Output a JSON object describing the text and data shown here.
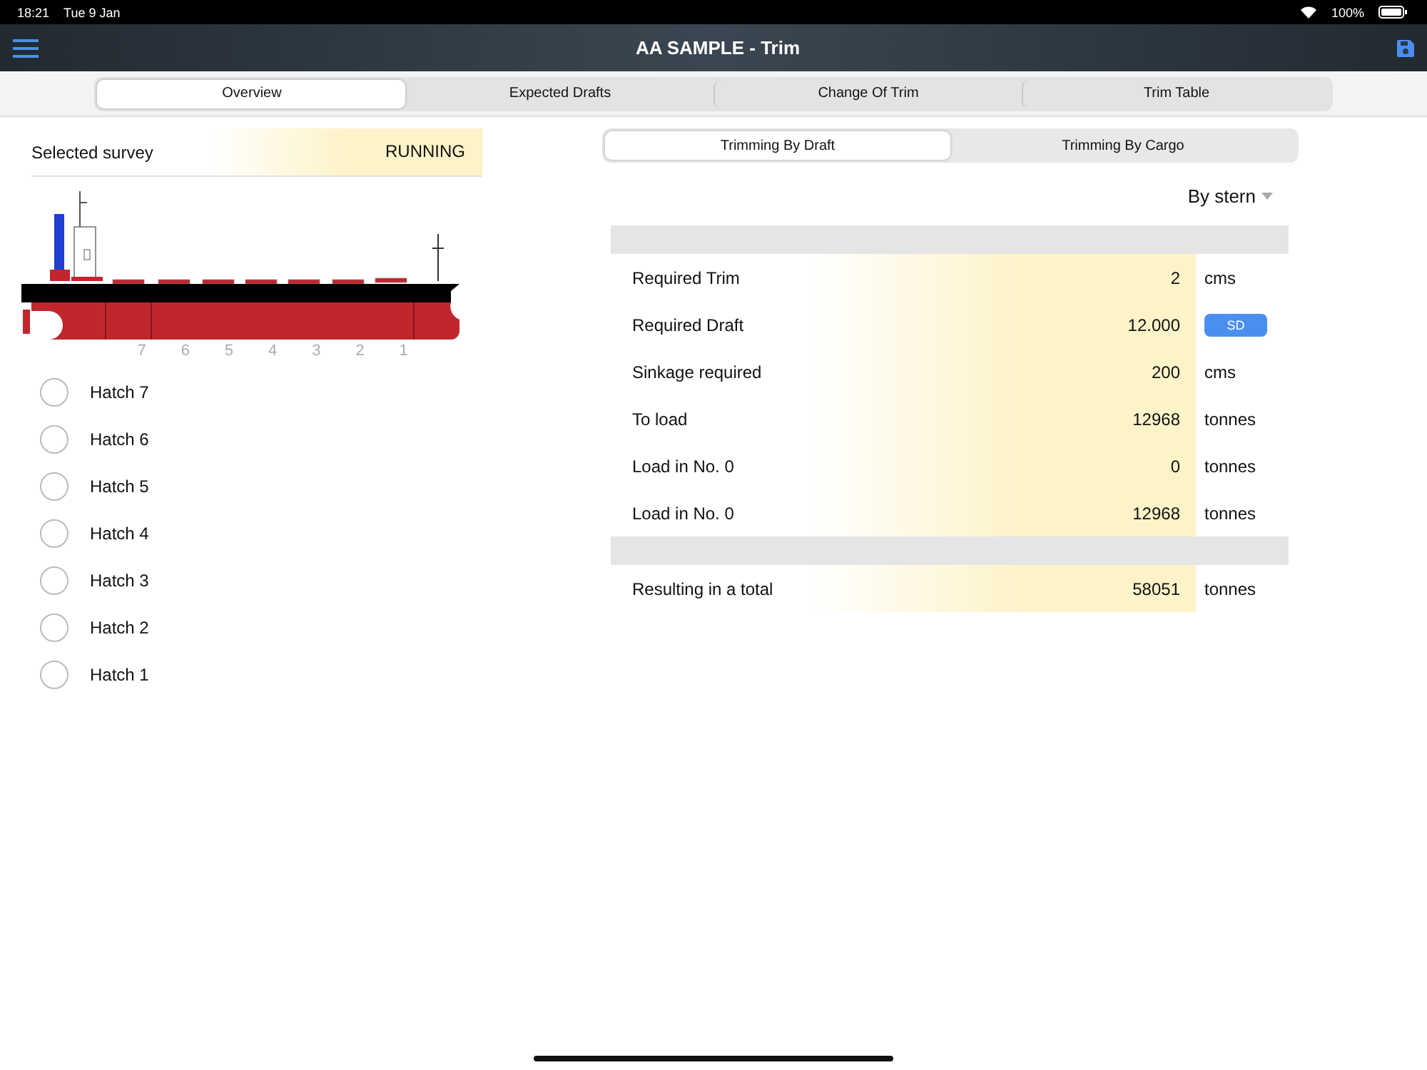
{
  "status_bar": {
    "time": "18:21",
    "date": "Tue 9 Jan",
    "battery": "100%"
  },
  "nav": {
    "title": "AA SAMPLE - Trim"
  },
  "tabs": [
    {
      "label": "Overview",
      "selected": true
    },
    {
      "label": "Expected Drafts",
      "selected": false
    },
    {
      "label": "Change Of Trim",
      "selected": false
    },
    {
      "label": "Trim Table",
      "selected": false
    }
  ],
  "survey": {
    "label": "Selected survey",
    "value": "RUNNING"
  },
  "hold_numbers": [
    "7",
    "6",
    "5",
    "4",
    "3",
    "2",
    "1"
  ],
  "hatches": [
    {
      "label": "Hatch 7",
      "selected": false
    },
    {
      "label": "Hatch 6",
      "selected": false
    },
    {
      "label": "Hatch 5",
      "selected": false
    },
    {
      "label": "Hatch 4",
      "selected": false
    },
    {
      "label": "Hatch 3",
      "selected": false
    },
    {
      "label": "Hatch 2",
      "selected": false
    },
    {
      "label": "Hatch 1",
      "selected": false
    }
  ],
  "mode_tabs": [
    {
      "label": "Trimming By Draft",
      "selected": true
    },
    {
      "label": "Trimming By Cargo",
      "selected": false
    }
  ],
  "trim_direction": "By stern",
  "rows": [
    {
      "kind": "text",
      "label": "Required Trim",
      "value": "2",
      "unit": "cms"
    },
    {
      "kind": "button",
      "label": "Required Draft",
      "value": "12.000",
      "unit": "SD"
    },
    {
      "kind": "text",
      "label": "Sinkage required",
      "value": "200",
      "unit": "cms"
    },
    {
      "kind": "text",
      "label": "To load",
      "value": "12968",
      "unit": "tonnes"
    },
    {
      "kind": "text",
      "label": "Load in No. 0",
      "value": "0",
      "unit": "tonnes"
    },
    {
      "kind": "text",
      "label": "Load in No. 0",
      "value": "12968",
      "unit": "tonnes"
    }
  ],
  "total": {
    "label": "Resulting in a total",
    "value": "58051",
    "unit": "tonnes"
  }
}
